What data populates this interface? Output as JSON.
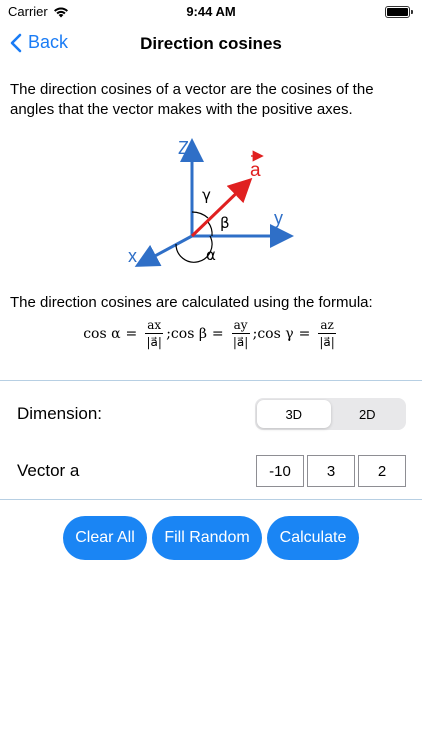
{
  "status": {
    "carrier": "Carrier",
    "time": "9:44 AM"
  },
  "nav": {
    "back_label": "Back",
    "title": "Direction cosines"
  },
  "intro_text": "The direction cosines of a vector are the cosines of the angles that the vector makes with the positive axes.",
  "diagram": {
    "z": "Z",
    "y": "y",
    "x": "x",
    "vector": "a",
    "alpha": "α",
    "beta": "β",
    "gamma": "γ"
  },
  "formula_label": "The direction cosines are calculated using the formula:",
  "formula": {
    "cos_a": "cos α",
    "cos_b": "cos β",
    "cos_g": "cos γ",
    "num_x": "ax",
    "num_y": "ay",
    "num_z": "az",
    "den": "|a⃗|"
  },
  "dimension": {
    "label": "Dimension:",
    "options": [
      "3D",
      "2D"
    ],
    "selected": "3D"
  },
  "vector": {
    "label": "Vector a",
    "values": [
      "-10",
      "3",
      "2"
    ]
  },
  "buttons": {
    "clear": "Clear All",
    "random": "Fill Random",
    "calculate": "Calculate"
  },
  "colors": {
    "accent": "#1a85f4",
    "axis": "#2f6fc7",
    "vector": "#e02020"
  }
}
